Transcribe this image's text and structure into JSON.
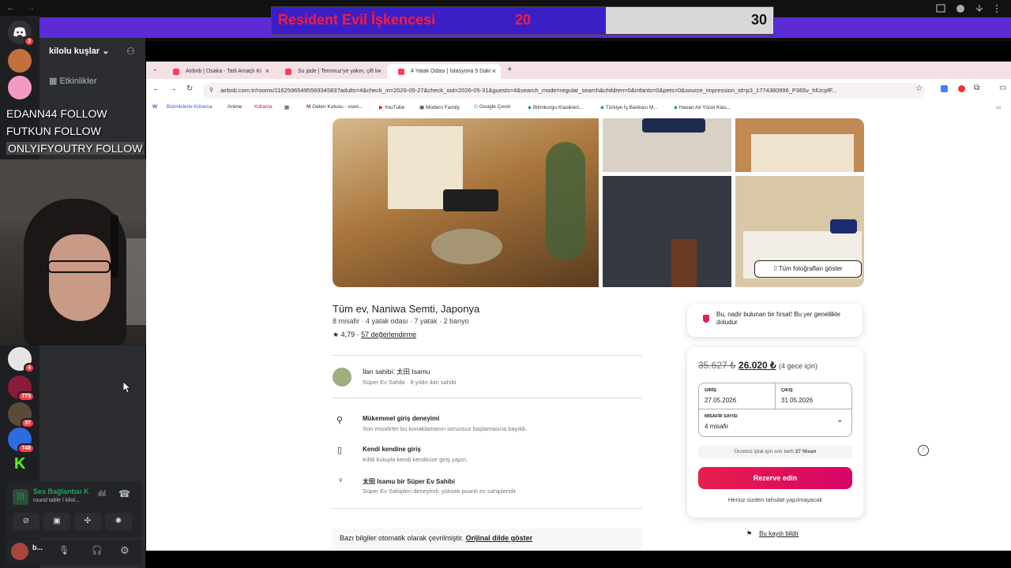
{
  "overlay": {
    "counter_title": "Resident Evil İşkencesi",
    "counter_current": "20",
    "counter_target": "30",
    "counter_progress": 0.6667,
    "follows": [
      "EDANN44 FOLLOW",
      "FUTKUN  FOLLOW",
      "ONLYIFYOUTRY  FOLLOW"
    ]
  },
  "discord": {
    "server_name": "kilolu kuşlar",
    "events_label": "Etkinlikler",
    "badges": [
      "3",
      "4",
      "773",
      "37",
      "748"
    ],
    "voice_title": "Ses Bağlantısı K",
    "voice_sub": "round table / kilol...",
    "user_name": "b..."
  },
  "browser": {
    "tabs": [
      {
        "label": "Airbnb | Osaka - Tatil Amaçlı Ki",
        "active": false
      },
      {
        "label": "Su jade | Temmuz'ye yakın, çift k",
        "active": false
      },
      {
        "label": "4 Yatak Odası | İstasyona 5 Daki",
        "active": true
      }
    ],
    "url": "airbnb.com.tr/rooms/1162596549556934583?adults=4&check_in=2026-05-27&check_out=2026-05-31&guests=4&search_mode=regular_search&children=0&infants=0&pets=0&source_impression_id=p3_1774380996_P365v_hlUcpfF...",
    "bookmarks": [
      "Bizimkilerle Kdrama",
      "Anime",
      "Kdrama",
      "Gelen Kutusu - ssen...",
      "YouTube",
      "Modern Family",
      "Google Çeviri",
      "Bilimkurgu Klasikleri...",
      "Türkiye İş Bankası M...",
      "Hasan Ali Yücel Klas..."
    ]
  },
  "listing": {
    "show_all_photos": "Tüm fotoğrafları göster",
    "title": "Tüm ev, Naniwa Semti, Japonya",
    "subtitle": "8 misafir · 4 yatak odası · 7 yatak · 2 banyo",
    "rating": "★ 4,79 · ",
    "reviews": "57 değerlendirme",
    "host_title": "İlan sahibi: 太田 Isamu",
    "host_sub": "Süper Ev Sahibi · 8 yıldır ilan sahibi",
    "features": [
      {
        "icon": "key-icon",
        "title": "Mükemmel giriş deneyimi",
        "desc": "Son misafirler bu konaklamanın sorunsuz başlamasına bayıldı."
      },
      {
        "icon": "lockbox-icon",
        "title": "Kendi kendine giriş",
        "desc": "Kilitli kutuyla kendi kendinize giriş yapın."
      },
      {
        "icon": "medal-icon",
        "title": "太田 Isamu bir Süper Ev Sahibi",
        "desc": "Süper Ev Sahipleri deneyimli, yüksek puanlı ev sahipleridir."
      }
    ],
    "translated_note": "Bazı bilgiler otomatik olarak çevrilmiştir. ",
    "original_link": "Orijinal dilde göster"
  },
  "booking": {
    "rare_text": "Bu, nadir bulunan bir fırsat! Bu yer genellikle doludur",
    "old_price": "35.627 ₺",
    "new_price": "26.020 ₺",
    "nights": "(4 gece için)",
    "checkin_label": "GİRİŞ",
    "checkin_value": "27.05.2026",
    "checkout_label": "ÇIKIŞ",
    "checkout_value": "31.05.2026",
    "guests_label": "MİSAFİR SAYISI",
    "guests_value": "4 misafir",
    "cancel_note_prefix": "Ücretsiz iptal için son tarih ",
    "cancel_date": "27 Nisan",
    "reserve_label": "Rezerve edin",
    "no_charge": "Henüz sizden tahsilat yapılmayacak",
    "report": "Bu kaydı bildir"
  },
  "colors": {
    "accent": "#e61e4d",
    "discord_bg": "#2b2d31",
    "stream_purple": "#5b2bd6"
  }
}
